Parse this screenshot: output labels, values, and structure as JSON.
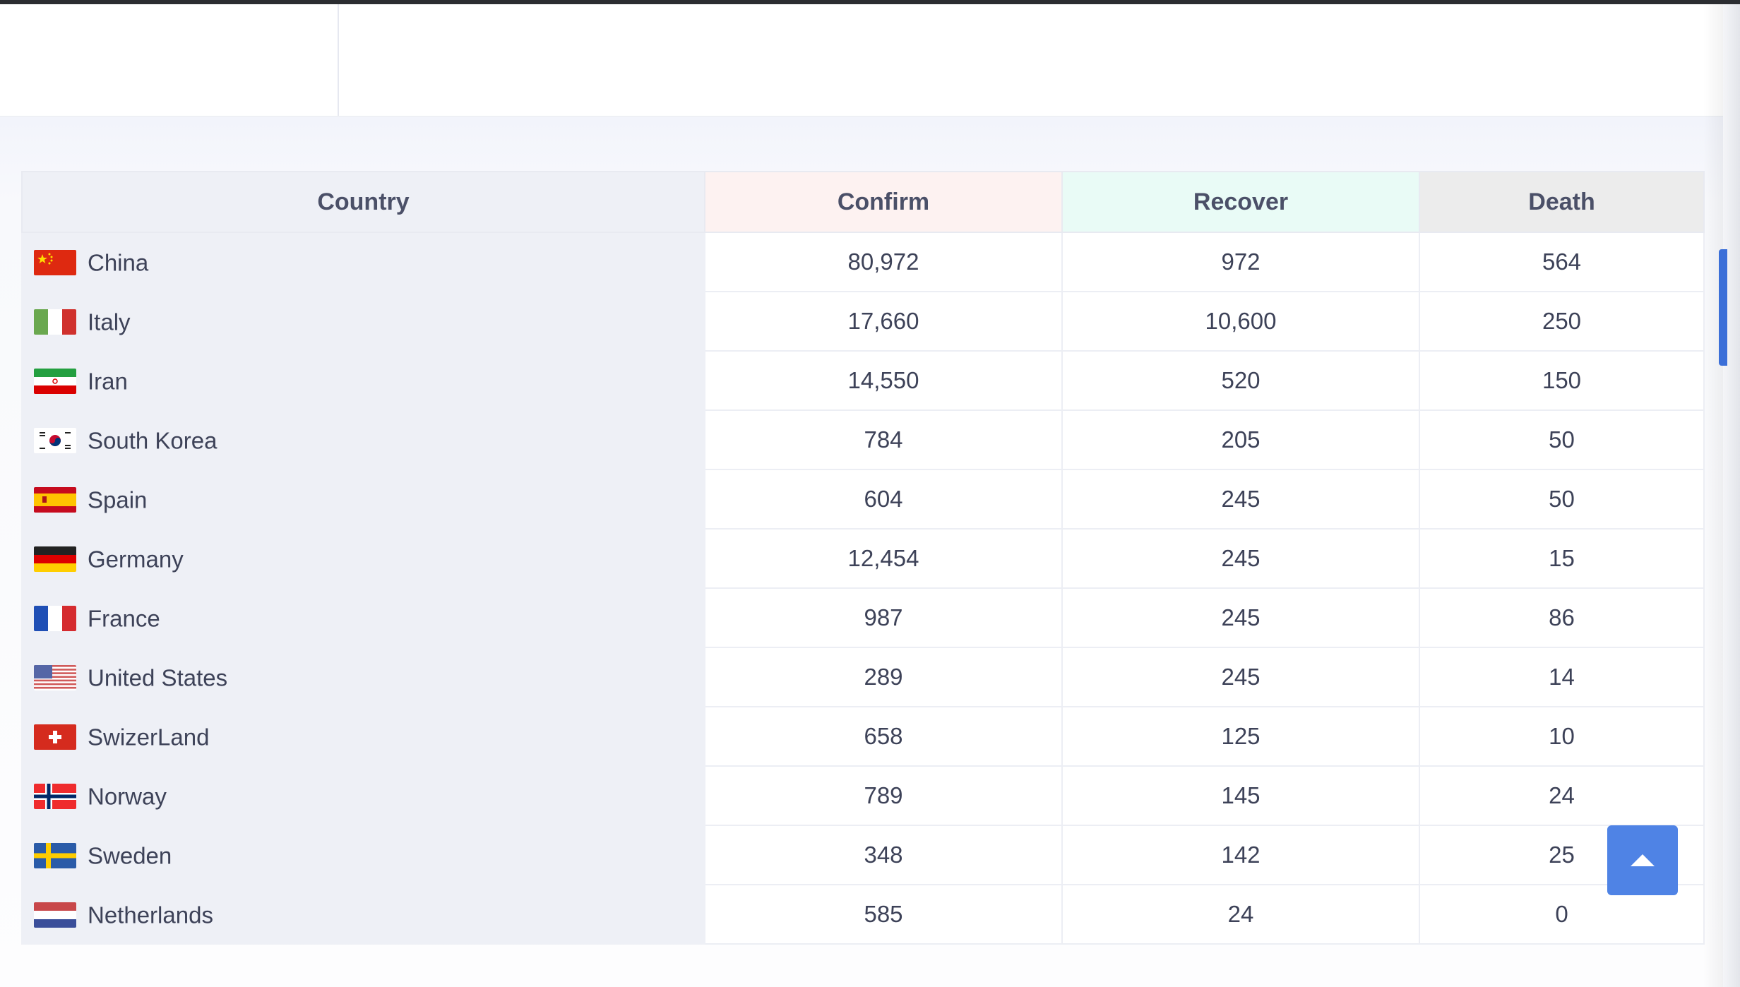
{
  "table": {
    "headers": {
      "country": "Country",
      "confirm": "Confirm",
      "recover": "Recover",
      "death": "Death"
    },
    "rows": [
      {
        "country": "China",
        "flag_icon": "china-flag-icon",
        "confirm": "80,972",
        "recover": "972",
        "death": "564"
      },
      {
        "country": "Italy",
        "flag_icon": "italy-flag-icon",
        "confirm": "17,660",
        "recover": "10,600",
        "death": "250"
      },
      {
        "country": "Iran",
        "flag_icon": "iran-flag-icon",
        "confirm": "14,550",
        "recover": "520",
        "death": "150"
      },
      {
        "country": "South Korea",
        "flag_icon": "south-korea-flag-icon",
        "confirm": "784",
        "recover": "205",
        "death": "50"
      },
      {
        "country": "Spain",
        "flag_icon": "spain-flag-icon",
        "confirm": "604",
        "recover": "245",
        "death": "50"
      },
      {
        "country": "Germany",
        "flag_icon": "germany-flag-icon",
        "confirm": "12,454",
        "recover": "245",
        "death": "15"
      },
      {
        "country": "France",
        "flag_icon": "france-flag-icon",
        "confirm": "987",
        "recover": "245",
        "death": "86"
      },
      {
        "country": "United States",
        "flag_icon": "united-states-flag-icon",
        "confirm": "289",
        "recover": "245",
        "death": "14"
      },
      {
        "country": "SwizerLand",
        "flag_icon": "switzerland-flag-icon",
        "confirm": "658",
        "recover": "125",
        "death": "10"
      },
      {
        "country": "Norway",
        "flag_icon": "norway-flag-icon",
        "confirm": "789",
        "recover": "145",
        "death": "24"
      },
      {
        "country": "Sweden",
        "flag_icon": "sweden-flag-icon",
        "confirm": "348",
        "recover": "142",
        "death": "25"
      },
      {
        "country": "Netherlands",
        "flag_icon": "netherlands-flag-icon",
        "confirm": "585",
        "recover": "24",
        "death": "0"
      }
    ]
  },
  "colors": {
    "header_confirm_bg": "#fdf2f1",
    "header_recover_bg": "#e9fbf6",
    "header_death_bg": "#ececec",
    "country_column_bg": "#eef0f6",
    "scroll_top_button": "#4f83e5",
    "scrollbar_thumb": "#3b6fd8"
  },
  "scroll_top_button": {
    "icon": "arrow-up-icon"
  }
}
